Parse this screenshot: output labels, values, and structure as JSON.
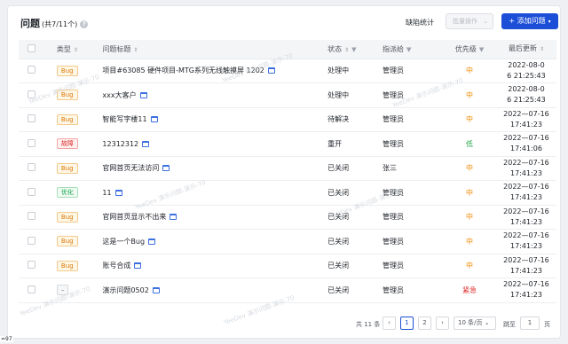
{
  "header": {
    "title": "问题",
    "count_text": "(共7/11个)",
    "stats_link": "缺陷统计",
    "batch_label": "批量操作",
    "add_label": "+ 添加问题"
  },
  "columns": {
    "type": "类型",
    "title": "问题标题",
    "status": "状态",
    "assignee": "指派给",
    "priority": "优先级",
    "updated": "最后更新"
  },
  "rows": [
    {
      "type": "Bug",
      "type_kind": "bug",
      "title": "项目#63085 硬件项目-MTG系列无线触摸屏 1202",
      "status": "处理中",
      "assignee": "管理员",
      "priority": "中",
      "prio_kind": "mid",
      "updated_date": "2022-08-0",
      "updated_time": "6 21:25:43"
    },
    {
      "type": "Bug",
      "type_kind": "bug",
      "title": "xxx大客户",
      "status": "处理中",
      "assignee": "管理员",
      "priority": "中",
      "prio_kind": "mid",
      "updated_date": "2022-08-0",
      "updated_time": "6 21:25:43"
    },
    {
      "type": "Bug",
      "type_kind": "bug",
      "title": "智能写字楼11",
      "status": "待解决",
      "assignee": "管理员",
      "priority": "中",
      "prio_kind": "mid",
      "updated_date": "2022—07-16",
      "updated_time": "17:41:23"
    },
    {
      "type": "故障",
      "type_kind": "fault",
      "title": "12312312",
      "status": "重开",
      "assignee": "管理员",
      "priority": "低",
      "prio_kind": "low",
      "updated_date": "2022—07-16",
      "updated_time": "17:41:06"
    },
    {
      "type": "Bug",
      "type_kind": "bug",
      "title": "官网首页无法访问",
      "status": "已关闭",
      "assignee": "张三",
      "priority": "中",
      "prio_kind": "mid",
      "updated_date": "2022—07-16",
      "updated_time": "17:41:23"
    },
    {
      "type": "优化",
      "type_kind": "opt",
      "title": "11",
      "status": "已关闭",
      "assignee": "管理员",
      "priority": "中",
      "prio_kind": "mid",
      "updated_date": "2022—07-16",
      "updated_time": "17:41:23"
    },
    {
      "type": "Bug",
      "type_kind": "bug",
      "title": "官网首页显示不出来",
      "status": "已关闭",
      "assignee": "管理员",
      "priority": "中",
      "prio_kind": "mid",
      "updated_date": "2022—07-16",
      "updated_time": "17:41:23"
    },
    {
      "type": "Bug",
      "type_kind": "bug",
      "title": "这是一个Bug",
      "status": "已关闭",
      "assignee": "管理员",
      "priority": "中",
      "prio_kind": "mid",
      "updated_date": "2022—07-16",
      "updated_time": "17:41:23"
    },
    {
      "type": "Bug",
      "type_kind": "bug",
      "title": "账号合成",
      "status": "已关闭",
      "assignee": "管理员",
      "priority": "中",
      "prio_kind": "mid",
      "updated_date": "2022—07-16",
      "updated_time": "17:41:23"
    },
    {
      "type": "–",
      "type_kind": "none",
      "title": "演示问题0502",
      "status": "已关闭",
      "assignee": "管理员",
      "priority": "紧急",
      "prio_kind": "urg",
      "updated_date": "2022—07-16",
      "updated_time": "17:41:23"
    }
  ],
  "pagination": {
    "total": "共 11 条",
    "prev": "‹",
    "pages": [
      "1",
      "2"
    ],
    "next": "›",
    "page_size": "10 条/页",
    "jump_label": "跳至",
    "jump_value": "1",
    "unit": "页"
  },
  "watermark": "YeeDev 演示问题-演示-70",
  "zoom_text": "=97",
  "colors": {
    "primary": "#1c4ed8",
    "bug": "#d97706",
    "fault": "#dc2626",
    "opt": "#16a34a",
    "urgent": "#e02424",
    "medium": "#f08a00",
    "low": "#22a447"
  }
}
